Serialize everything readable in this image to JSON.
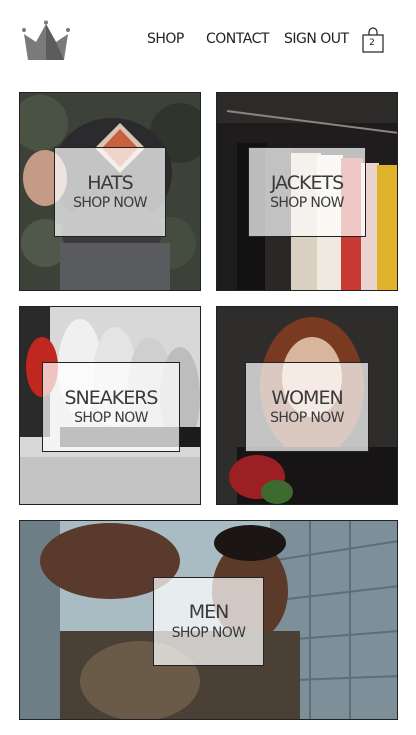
{
  "header": {
    "logo_icon": "crown-icon",
    "nav": [
      {
        "label": "SHOP"
      },
      {
        "label": "CONTACT"
      },
      {
        "label": "SIGN OUT"
      }
    ],
    "cart": {
      "icon": "shopping-bag-icon",
      "count": "2"
    }
  },
  "categories": [
    {
      "title": "HATS",
      "cta": "SHOP NOW"
    },
    {
      "title": "JACKETS",
      "cta": "SHOP NOW"
    },
    {
      "title": "SNEAKERS",
      "cta": "SHOP NOW"
    },
    {
      "title": "WOMEN",
      "cta": "SHOP NOW"
    },
    {
      "title": "MEN",
      "cta": "SHOP NOW"
    }
  ]
}
